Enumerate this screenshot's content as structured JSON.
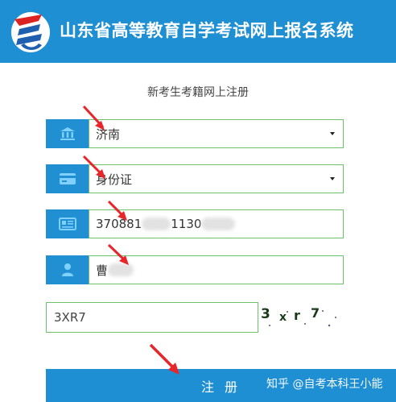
{
  "header": {
    "title": "山东省高等教育自学考试网上报名系统",
    "logo_icon": "exam-system-logo-icon",
    "bg_color": "#1f8fd3"
  },
  "form": {
    "title": "新考生考籍网上注册",
    "city_select": {
      "value": "济南",
      "icon": "institution-icon"
    },
    "id_type_select": {
      "value": "身份证",
      "icon": "id-card-icon"
    },
    "id_number": {
      "value_visible_prefix": "370881",
      "value_visible_mid": "1130",
      "icon": "id-badge-icon"
    },
    "name": {
      "value_visible": "曹",
      "icon": "user-icon"
    },
    "captcha_input": {
      "value": "3XR7"
    },
    "captcha_image": {
      "chars": [
        "3",
        "x",
        "r",
        "7"
      ]
    },
    "register_button": {
      "label": "注 册"
    }
  },
  "watermark": "知乎 @自考本科王小能",
  "colors": {
    "accent": "#2090d2",
    "field_border": "#6cc36b",
    "arrow": "#e8262a"
  }
}
